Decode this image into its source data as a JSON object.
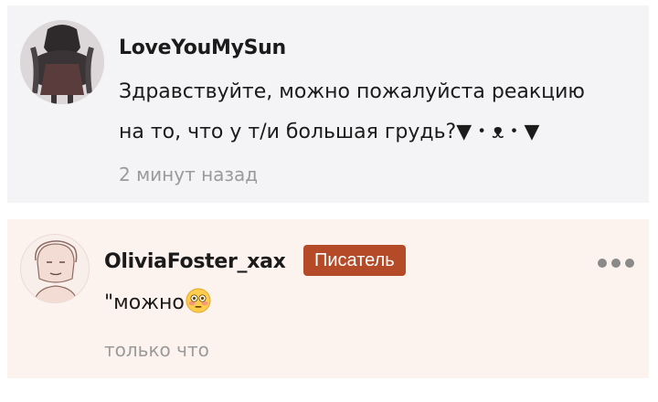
{
  "comments": [
    {
      "username": "LoveYouMySun",
      "text_line1": "Здравствуйте, можно пожалуйста реакцию",
      "text_line2": "на то, что у т/и большая грудь?▼・ᴥ・▼",
      "timestamp": "2 минут назад"
    },
    {
      "username": "OliviaFoster_xax",
      "badge": "Писатель",
      "text": "\"можно",
      "emoji": "flushed-face-emoji",
      "timestamp": "только что"
    }
  ],
  "colors": {
    "card1_bg": "#f4f3f5",
    "card2_bg": "#fdf3ee",
    "badge_bg": "#b44a28",
    "timestamp": "#9a9a9a"
  }
}
